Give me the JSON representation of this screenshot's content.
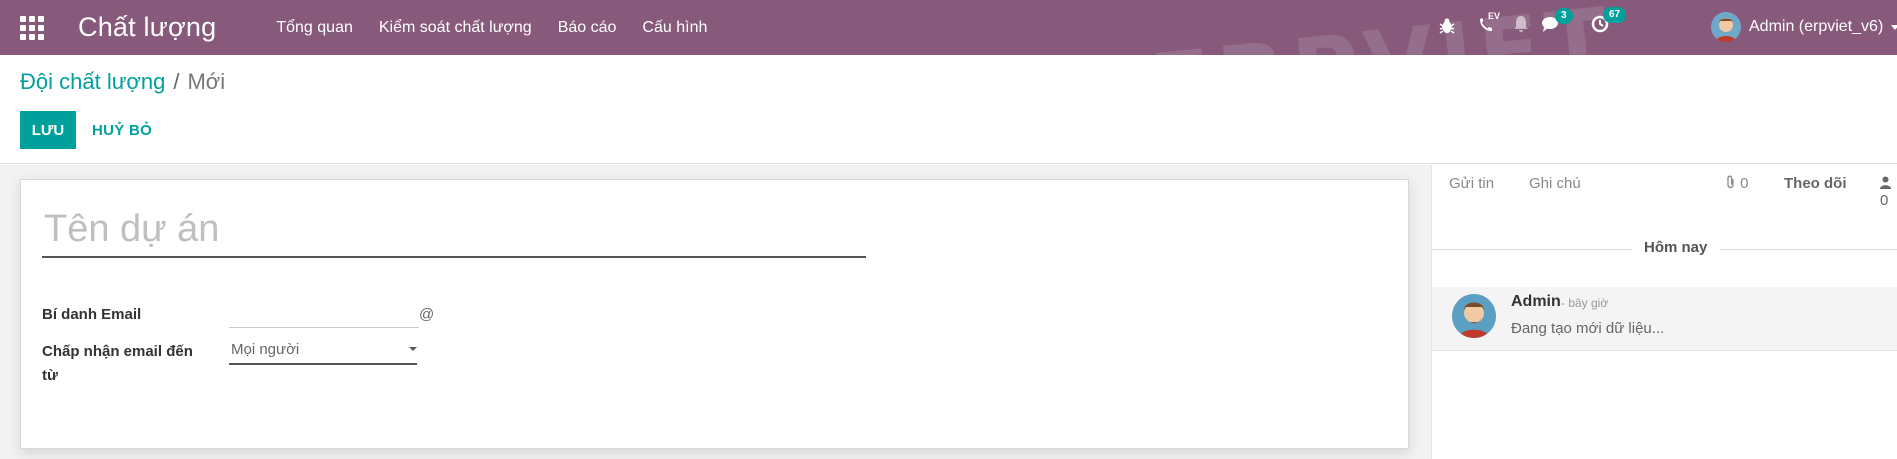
{
  "navbar": {
    "app_title": "Chất lượng",
    "menu": [
      "Tổng quan",
      "Kiểm soát chất lượng",
      "Báo cáo",
      "Cấu hình"
    ],
    "phone_label": "EV",
    "messages_count": "3",
    "activities_count": "67",
    "user_name": "Admin (erpviet_v6)",
    "bg_color": "#875a7b"
  },
  "watermark": "ERPVIET",
  "breadcrumb": {
    "parent": "Đội chất lượng",
    "separator": "/",
    "current": "Mới"
  },
  "toolbar": {
    "save_label": "LƯU",
    "discard_label": "HUỶ BỎ",
    "accent_color": "#00a09d"
  },
  "form": {
    "name_placeholder": "Tên dự án",
    "alias_label": "Bí danh Email",
    "alias_value": "",
    "alias_suffix": "@",
    "accept_label": "Chấp nhận email đến từ",
    "accept_value": "Mọi người"
  },
  "chatter": {
    "send_message": "Gửi tin",
    "log_note": "Ghi chú",
    "attachments_count": "0",
    "follow": "Theo dõi",
    "followers_count": "0",
    "date_separator": "Hôm nay",
    "messages": [
      {
        "author": "Admin",
        "time": "- bây giờ",
        "body": "Đang tạo mới dữ liệu..."
      }
    ]
  }
}
